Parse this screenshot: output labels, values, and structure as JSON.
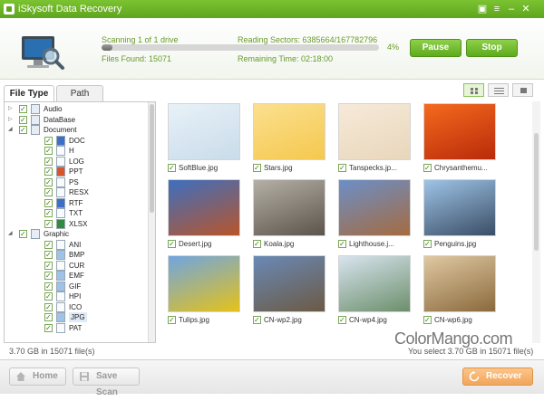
{
  "window": {
    "title": "iSkysoft Data Recovery"
  },
  "scan": {
    "status": "Scanning 1 of 1 drive",
    "reading_sectors": "Reading Sectors: 6385664/167782796",
    "files_found": "Files Found: 15071",
    "remaining_time": "Remaining Time: 02:18:00",
    "progress_pct": 4,
    "progress_label": "4%",
    "pause_label": "Pause",
    "stop_label": "Stop"
  },
  "tabs": [
    "File Type",
    "Path"
  ],
  "tree": [
    {
      "label": "Audio",
      "arrow": "▷",
      "icon": "folder",
      "level": 0
    },
    {
      "label": "DataBase",
      "arrow": "▷",
      "icon": "folder",
      "level": 0
    },
    {
      "label": "Document",
      "arrow": "◢",
      "icon": "folder",
      "level": 0
    },
    {
      "label": "DOC",
      "icon": "doc-file",
      "level": 1
    },
    {
      "label": "H",
      "icon": "file",
      "level": 1
    },
    {
      "label": "LOG",
      "icon": "file",
      "level": 1
    },
    {
      "label": "PPT",
      "icon": "ppt-file",
      "level": 1
    },
    {
      "label": "PS",
      "icon": "file",
      "level": 1
    },
    {
      "label": "RESX",
      "icon": "file",
      "level": 1
    },
    {
      "label": "RTF",
      "icon": "doc-file",
      "level": 1
    },
    {
      "label": "TXT",
      "icon": "file",
      "level": 1
    },
    {
      "label": "XLSX",
      "icon": "xls-file",
      "level": 1
    },
    {
      "label": "Graphic",
      "arrow": "◢",
      "icon": "folder",
      "level": 0
    },
    {
      "label": "ANI",
      "icon": "file",
      "level": 1
    },
    {
      "label": "BMP",
      "icon": "image-file",
      "level": 1
    },
    {
      "label": "CUR",
      "icon": "file",
      "level": 1
    },
    {
      "label": "EMF",
      "icon": "image-file",
      "level": 1
    },
    {
      "label": "GIF",
      "icon": "image-file",
      "level": 1
    },
    {
      "label": "HPI",
      "icon": "file",
      "level": 1
    },
    {
      "label": "ICO",
      "icon": "file",
      "level": 1
    },
    {
      "label": "JPG",
      "icon": "image-file",
      "level": 1,
      "selected": true
    },
    {
      "label": "PAT",
      "icon": "file",
      "level": 1
    }
  ],
  "thumbnails": [
    {
      "name": "SoftBlue.jpg",
      "colors": [
        "#e8f1f8",
        "#c9dcea"
      ]
    },
    {
      "name": "Stars.jpg",
      "colors": [
        "#fbe08f",
        "#f5c84e"
      ]
    },
    {
      "name": "Tanspecks.jp...",
      "colors": [
        "#f6ead9",
        "#e9d6bb"
      ]
    },
    {
      "name": "Chrysanthemu...",
      "colors": [
        "#f56a1e",
        "#b92a0a"
      ]
    },
    {
      "name": "Desert.jpg",
      "colors": [
        "#3d6fbf",
        "#b8552a"
      ]
    },
    {
      "name": "Koala.jpg",
      "colors": [
        "#b5b0a6",
        "#5b544b"
      ]
    },
    {
      "name": "Lighthouse.j...",
      "colors": [
        "#6b8fc8",
        "#a56b3f"
      ]
    },
    {
      "name": "Penguins.jpg",
      "colors": [
        "#9ec4e6",
        "#3a4d66"
      ]
    },
    {
      "name": "Tulips.jpg",
      "colors": [
        "#6fa5e0",
        "#e5c21a"
      ]
    },
    {
      "name": "CN-wp2.jpg",
      "colors": [
        "#6a89b6",
        "#6b5a44"
      ]
    },
    {
      "name": "CN-wp4.jpg",
      "colors": [
        "#d8e4ef",
        "#6c8f6b"
      ]
    },
    {
      "name": "CN-wp6.jpg",
      "colors": [
        "#e0c8a2",
        "#8a6a3c"
      ]
    }
  ],
  "status": {
    "left": "3.70 GB in 15071 file(s)",
    "right": "You select 3.70 GB in 15071 file(s)"
  },
  "watermark": "ColorMango.com",
  "bottom": {
    "home_label": "Home",
    "save_scan_label": "Save Scan",
    "recover_label": "Recover"
  },
  "colors": {
    "brand_green": "#6ab42a",
    "recover_orange": "#f1a65c"
  }
}
